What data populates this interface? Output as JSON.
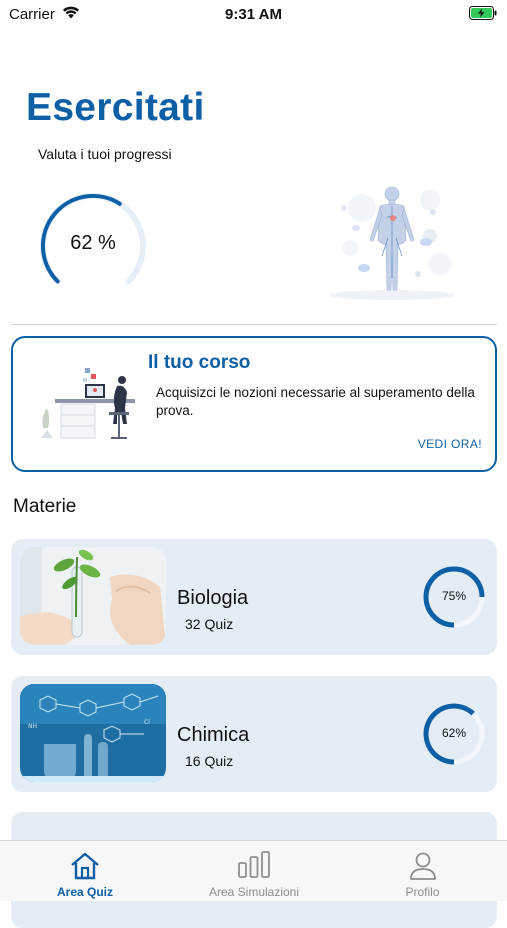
{
  "status_bar": {
    "carrier": "Carrier",
    "time": "9:31 AM"
  },
  "header": {
    "title": "Esercitati",
    "subtitle": "Valuta i tuoi progressi"
  },
  "overall_progress": {
    "label": "62 %",
    "value": 0.62
  },
  "course_card": {
    "title": "Il tuo corso",
    "description": "Acquisizci le nozioni necessarie al superamento della prova.",
    "cta": "VEDI ORA!"
  },
  "subjects": {
    "title": "Materie",
    "items": [
      {
        "name": "Biologia",
        "count": "32 Quiz",
        "percent_label": "75%",
        "value": 0.75
      },
      {
        "name": "Chimica",
        "count": "16 Quiz",
        "percent_label": "62%",
        "value": 0.62
      }
    ]
  },
  "tabs": [
    {
      "label": "Area Quiz",
      "icon": "home-icon",
      "active": true
    },
    {
      "label": "Area Simulazioni",
      "icon": "bar-chart-icon",
      "active": false
    },
    {
      "label": "Profilo",
      "icon": "user-icon",
      "active": false
    }
  ],
  "colors": {
    "accent": "#0d5fa6",
    "card_background": "#e4edf6",
    "ring_track": "#e6eef7"
  }
}
